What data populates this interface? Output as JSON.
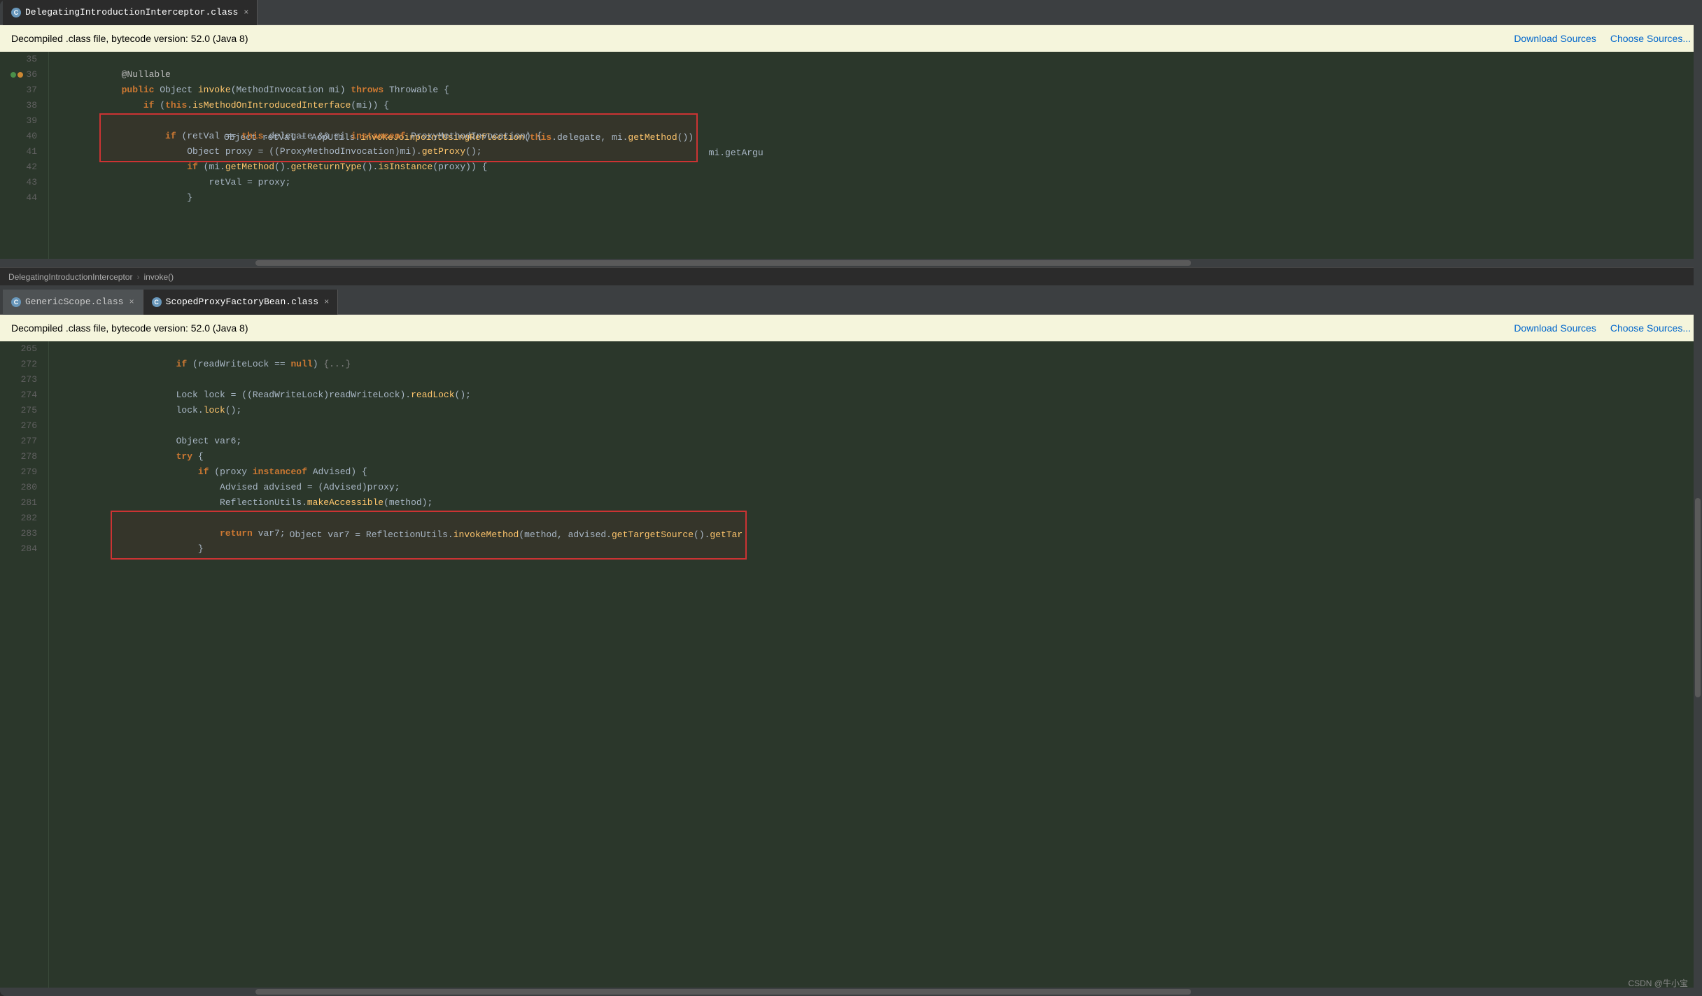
{
  "topPanel": {
    "tab": {
      "label": "DelegatingIntroductionInterceptor.class",
      "icon": "C"
    },
    "notificationBar": {
      "text": "Decompiled .class file, bytecode version: 52.0 (Java 8)",
      "downloadSources": "Download Sources",
      "chooseSources": "Choose Sources..."
    },
    "breadcrumb": {
      "class": "DelegatingIntroductionInterceptor",
      "sep": "›",
      "method": "invoke()"
    }
  },
  "bottomPanel": {
    "tabs": [
      {
        "label": "GenericScope.class",
        "icon": "C"
      },
      {
        "label": "ScopedProxyFactoryBean.class",
        "icon": "C",
        "active": true
      }
    ],
    "notificationBar": {
      "text": "Decompiled .class file, bytecode version: 52.0 (Java 8)",
      "downloadSources": "Download Sources",
      "chooseSources": "Choose Sources..."
    }
  },
  "watermark": "CSDN @牛小宝"
}
